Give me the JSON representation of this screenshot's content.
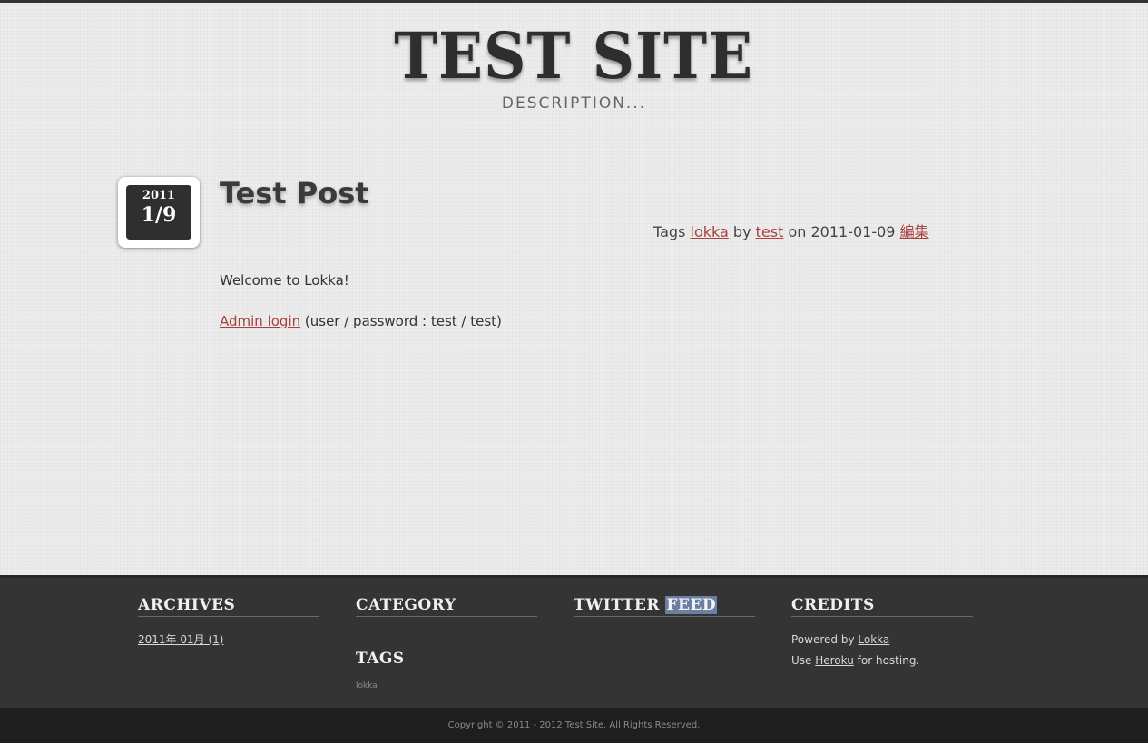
{
  "site": {
    "title": "TEST SITE",
    "description": "DESCRIPTION..."
  },
  "post": {
    "date_year": "2011",
    "date_day": "1/9",
    "title": "Test Post",
    "meta": {
      "tags_prefix": "Tags",
      "tag": "lokka",
      "by_prefix": "by",
      "author": "test",
      "on_prefix": "on",
      "date": "2011-01-09",
      "edit_label": "編集"
    },
    "body_line1": "Welcome to Lokka!",
    "admin_link": "Admin login",
    "credentials_text": " (user / password : test / test)"
  },
  "footer": {
    "archives": {
      "title": "ARCHIVES",
      "items": [
        "2011年 01月 (1)"
      ]
    },
    "category": {
      "title": "CATEGORY"
    },
    "tags": {
      "title": "TAGS",
      "items": [
        "lokka"
      ]
    },
    "twitter": {
      "title_prefix": "TWITTER",
      "title_highlight": "FEED"
    },
    "credits": {
      "title": "CREDITS",
      "line1_prefix": "Powered by ",
      "line1_link": "Lokka",
      "line2_prefix": "Use ",
      "line2_link": "Heroku",
      "line2_suffix": " for hosting."
    }
  },
  "copyright": "Copyright © 2011 - 2012 Test Site. All Rights Reserved.",
  "colors": {
    "link": "#a8413f",
    "footer_bg": "#343434",
    "copyright_bg": "#1e1e1e",
    "selection_highlight": "#6b7fa3"
  }
}
